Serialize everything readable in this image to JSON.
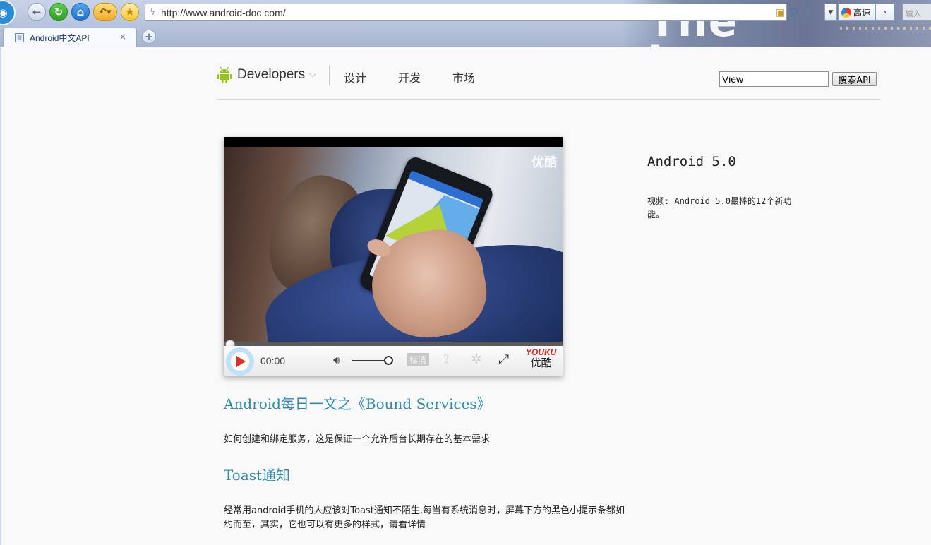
{
  "browser": {
    "address_url": "http://www.android-doc.com/",
    "speed_label": "高速",
    "search_placeholder": "输入",
    "tab_title": "Android中文API",
    "tab_close": "×",
    "new_tab": "+",
    "background_word": "The journey",
    "icons": {
      "logo": "browser-logo-icon",
      "back": "back-arrow-icon",
      "refresh": "refresh-icon",
      "home": "home-icon",
      "undo": "undo-icon",
      "favorite": "star-icon"
    }
  },
  "site": {
    "brand": "Developers",
    "nav": [
      "设计",
      "开发",
      "市场"
    ],
    "search_value": "View",
    "search_button": "搜索API"
  },
  "video": {
    "watermark": "优酷",
    "time": "00:00",
    "quality": "标清",
    "logo_en": "YOUKU",
    "logo_cn": "优酷",
    "progress": 0,
    "volume": 1.0
  },
  "articles": [
    {
      "title": "Android每日一文之《Bound Services》",
      "description": "如何创建和绑定服务，这是保证一个允许后台长期存在的基本需求"
    },
    {
      "title": "Toast通知",
      "description": "经常用android手机的人应该对Toast通知不陌生,每当有系统消息时，屏幕下方的黑色小提示条都如约而至，其实，它也可以有更多的样式，请看详情"
    }
  ],
  "sidebar": {
    "title": "Android 5.0",
    "description": "视频: Android 5.0最棒的12个新功能。"
  },
  "colors": {
    "link": "#2e8ab0",
    "android_green": "#97c024",
    "youku_red": "#e3241b"
  }
}
